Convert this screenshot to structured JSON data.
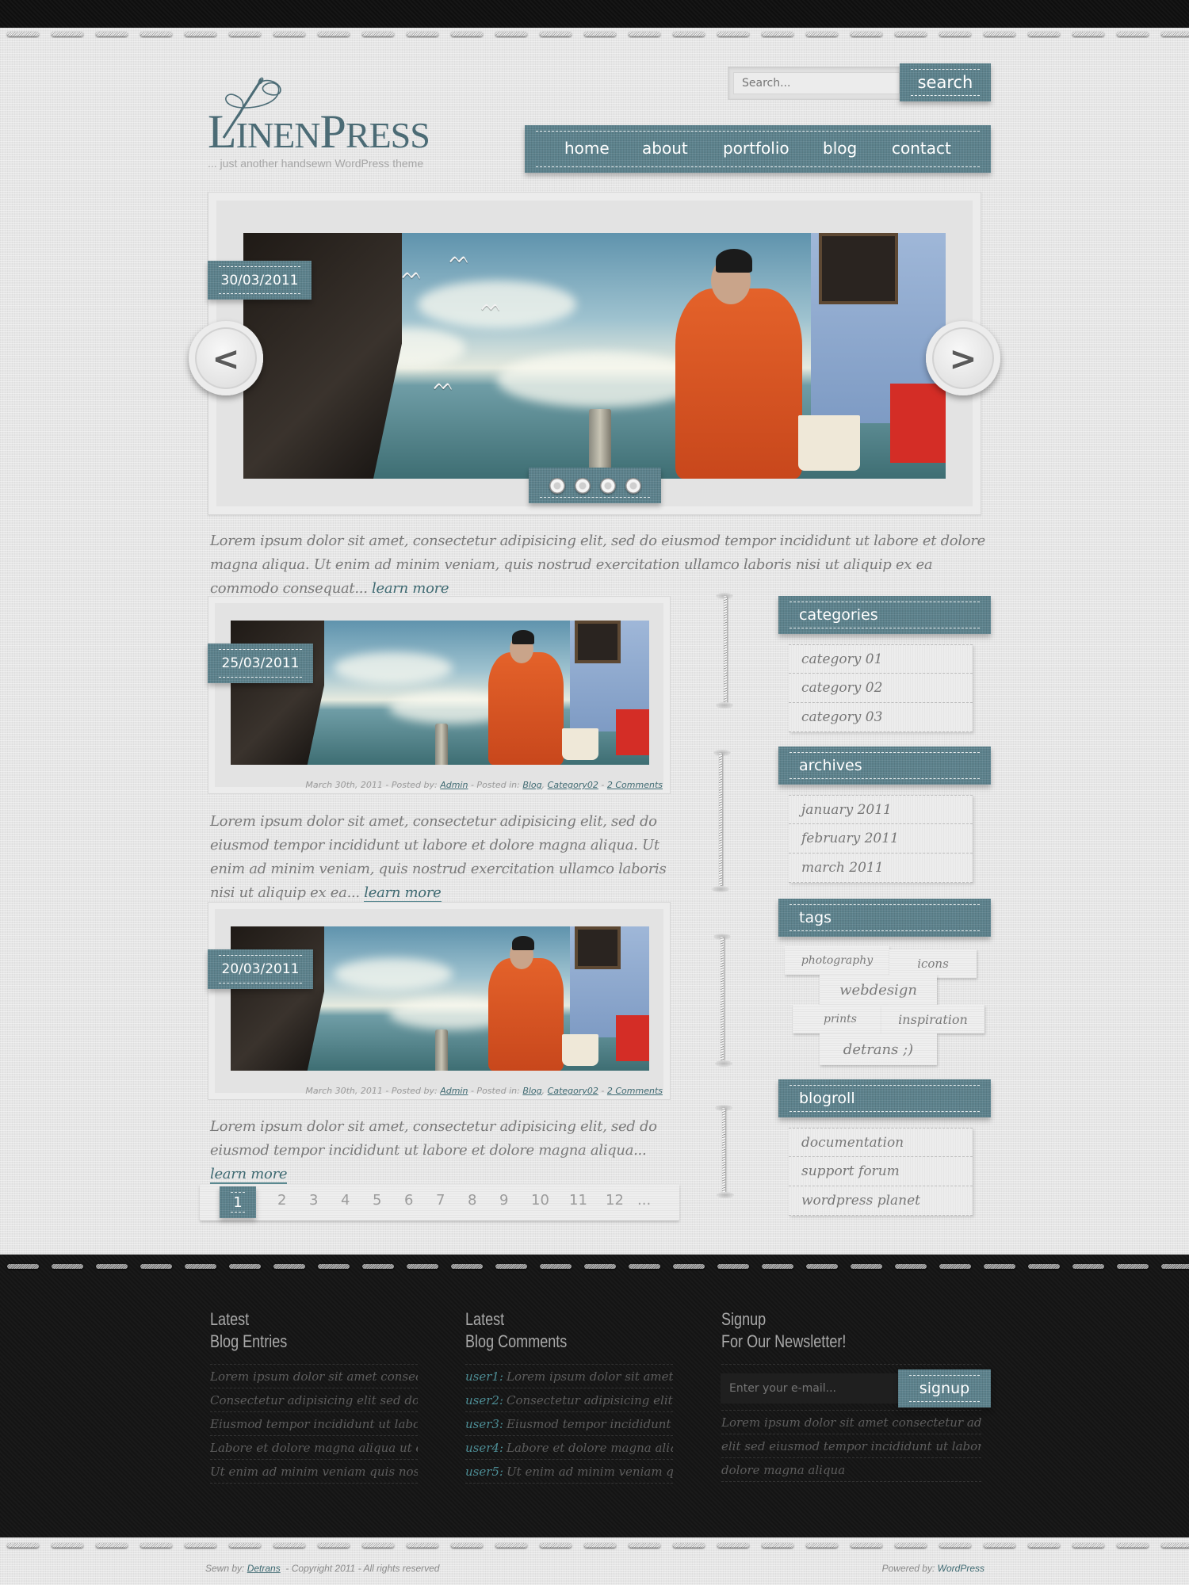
{
  "site": {
    "logo_first": "L",
    "logo_rest_1": "INEN",
    "logo_p": "P",
    "logo_rest_2": "RESS",
    "tagline": "... just another handsewn WordPress theme"
  },
  "search": {
    "placeholder": "Search...",
    "button_label": "search"
  },
  "nav": {
    "items": [
      {
        "label": "home"
      },
      {
        "label": "about"
      },
      {
        "label": "portfolio"
      },
      {
        "label": "blog"
      },
      {
        "label": "contact"
      }
    ]
  },
  "slider": {
    "date": "30/03/2011",
    "prev_icon": "chevron-left-icon",
    "next_icon": "chevron-right-icon",
    "prev_glyph": "<",
    "next_glyph": ">",
    "dots_count": 4
  },
  "intro": {
    "text": "Lorem ipsum dolor sit amet, consectetur adipisicing elit, sed do eiusmod tempor incididunt ut labore et dolore magna aliqua. Ut enim ad minim veniam, quis nostrud exercitation ullamco laboris nisi ut aliquip ex ea commodo consequat...",
    "learn_more": "learn more"
  },
  "posts": [
    {
      "date": "25/03/2011",
      "meta_date": "March 30th, 2011",
      "posted_by_label": " - Posted by: ",
      "author": "Admin",
      "posted_in_label": " - Posted in: ",
      "category1": "Blog",
      "category2": "Category02",
      "comments": "2 Comments",
      "excerpt": "Lorem ipsum dolor sit amet, consectetur adipisicing elit, sed do eiusmod tempor incididunt ut labore et dolore magna aliqua. Ut enim ad minim veniam, quis nostrud exercitation ullamco laboris nisi ut aliquip ex ea...",
      "learn_more": "learn more"
    },
    {
      "date": "20/03/2011",
      "meta_date": "March 30th, 2011",
      "posted_by_label": " - Posted by: ",
      "author": "Admin",
      "posted_in_label": " - Posted in: ",
      "category1": "Blog",
      "category2": "Category02",
      "comments": "2 Comments",
      "excerpt": "Lorem ipsum dolor sit amet, consectetur adipisicing elit, sed do eiusmod tempor incididunt ut labore et dolore magna aliqua...",
      "learn_more": "learn more"
    }
  ],
  "pagination": {
    "current": "1",
    "pages": [
      "2",
      "3",
      "4",
      "5",
      "6",
      "7",
      "8",
      "9",
      "10",
      "11",
      "12",
      "..."
    ]
  },
  "sidebar": {
    "categories": {
      "title": "categories",
      "items": [
        "category 01",
        "category 02",
        "category 03"
      ]
    },
    "archives": {
      "title": "archives",
      "items": [
        "january 2011",
        "february 2011",
        "march 2011"
      ]
    },
    "tags": {
      "title": "tags",
      "items": [
        "photography",
        "icons",
        "webdesign",
        "prints",
        "inspiration",
        "detrans ;)"
      ]
    },
    "blogroll": {
      "title": "blogroll",
      "items": [
        "documentation",
        "support forum",
        "wordpress planet"
      ]
    }
  },
  "footer": {
    "entries": {
      "title_1": "Latest",
      "title_2": "Blog Entries",
      "items": [
        "Lorem ipsum dolor sit amet consectetur",
        "Consectetur adipisicing elit sed do",
        "Eiusmod tempor incididunt ut labore et",
        "Labore et dolore magna aliqua ut enim",
        "Ut enim ad minim veniam quis nostrud"
      ]
    },
    "comments": {
      "title_1": "Latest",
      "title_2": "Blog Comments",
      "items": [
        {
          "user": "user1:",
          "text": "Lorem ipsum dolor sit amet"
        },
        {
          "user": "user2:",
          "text": "Consectetur adipisicing elit"
        },
        {
          "user": "user3:",
          "text": "Eiusmod tempor incididunt ut"
        },
        {
          "user": "user4:",
          "text": "Labore et dolore magna aliqua"
        },
        {
          "user": "user5:",
          "text": "Ut enim ad minim veniam quis"
        }
      ]
    },
    "newsletter": {
      "title_1": "Signup",
      "title_2": "For Our Newsletter!",
      "email_placeholder": "Enter your e-mail...",
      "button_label": "signup",
      "lines": [
        "Lorem ipsum dolor sit amet consectetur adipisicing",
        "elit sed eiusmod tempor incididunt ut labore et",
        "dolore magna aliqua"
      ]
    }
  },
  "copyright": {
    "sewn_by_label": "Sewn by: ",
    "author_link": "Detrans",
    "rights": "  - Copyright 2011 - All rights reserved",
    "powered_label": "Powered by: ",
    "powered_link": "WordPress"
  },
  "colors": {
    "denim": "#5f8590",
    "link": "#3f6a72",
    "linen": "#e6e6e6",
    "footer": "#141414",
    "user_accent": "#4d8d95"
  }
}
